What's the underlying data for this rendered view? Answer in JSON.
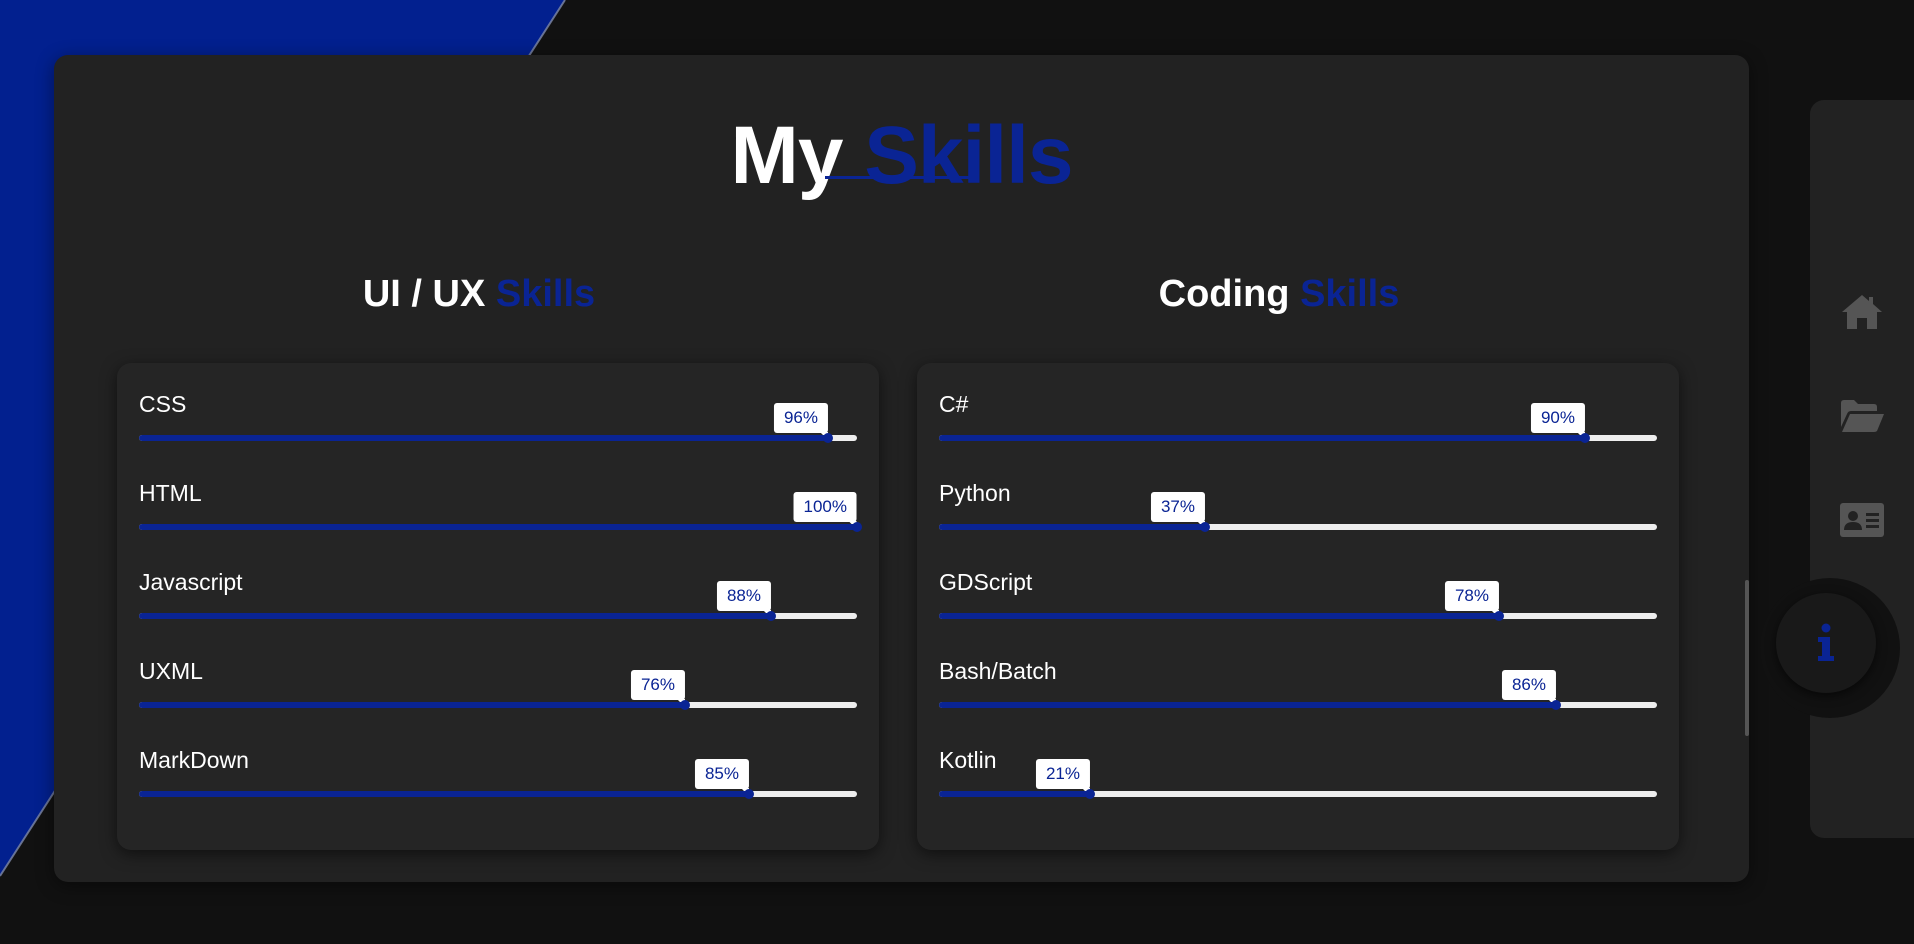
{
  "page": {
    "title_main": "My",
    "title_accent": "Skills"
  },
  "colors": {
    "accent": "#0a2494",
    "background": "#111111",
    "panel": "#222222",
    "track": "#eeeeee"
  },
  "ui_ux": {
    "title_main": "UI / UX",
    "title_accent": "Skills",
    "skills": [
      {
        "name": "CSS",
        "percent": 96,
        "label": "96%"
      },
      {
        "name": "HTML",
        "percent": 100,
        "label": "100%"
      },
      {
        "name": "Javascript",
        "percent": 88,
        "label": "88%"
      },
      {
        "name": "UXML",
        "percent": 76,
        "label": "76%"
      },
      {
        "name": "MarkDown",
        "percent": 85,
        "label": "85%"
      }
    ]
  },
  "coding": {
    "title_main": "Coding",
    "title_accent": "Skills",
    "skills": [
      {
        "name": "C#",
        "percent": 90,
        "label": "90%"
      },
      {
        "name": "Python",
        "percent": 37,
        "label": "37%"
      },
      {
        "name": "GDScript",
        "percent": 78,
        "label": "78%"
      },
      {
        "name": "Bash/Batch",
        "percent": 86,
        "label": "86%"
      },
      {
        "name": "Kotlin",
        "percent": 21,
        "label": "21%"
      }
    ]
  },
  "nav": {
    "items": [
      {
        "icon": "home-icon"
      },
      {
        "icon": "folder-open-icon"
      },
      {
        "icon": "contact-card-icon"
      },
      {
        "icon": "info-icon",
        "active": true
      }
    ]
  }
}
